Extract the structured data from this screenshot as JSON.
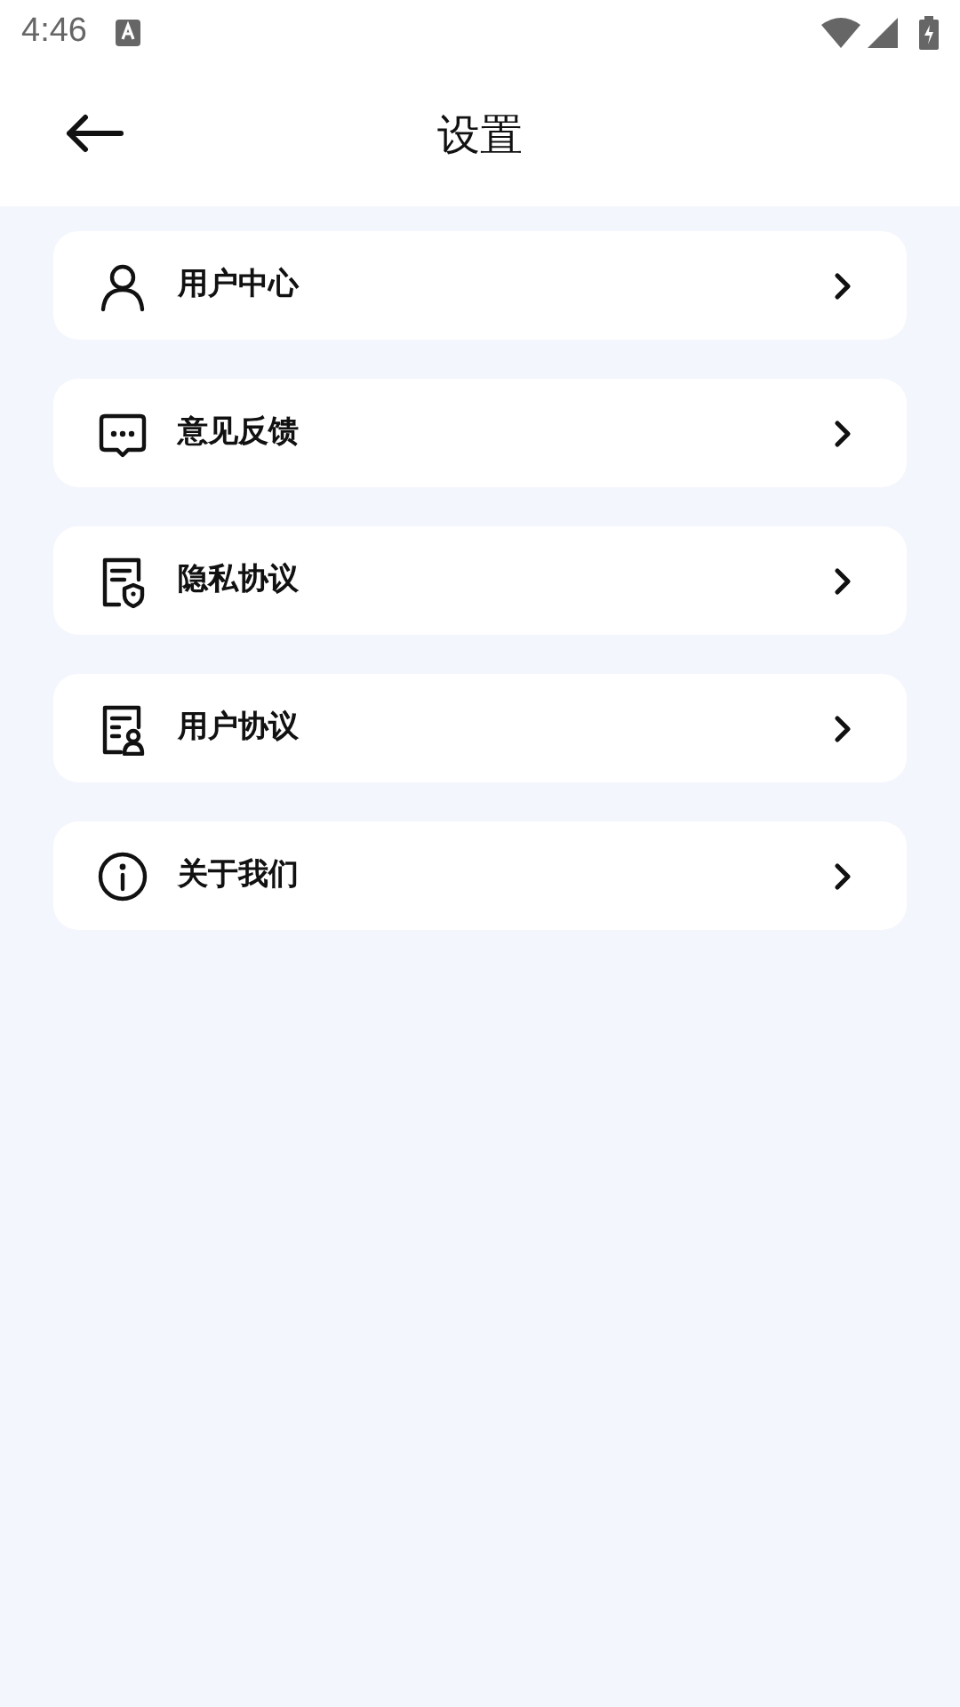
{
  "status_bar": {
    "time": "4:46"
  },
  "header": {
    "title": "设置"
  },
  "items": [
    {
      "label": "用户中心",
      "kind": "user"
    },
    {
      "label": "意见反馈",
      "kind": "feedback"
    },
    {
      "label": "隐私协议",
      "kind": "privacy"
    },
    {
      "label": "用户协议",
      "kind": "agreement"
    },
    {
      "label": "关于我们",
      "kind": "about"
    }
  ]
}
